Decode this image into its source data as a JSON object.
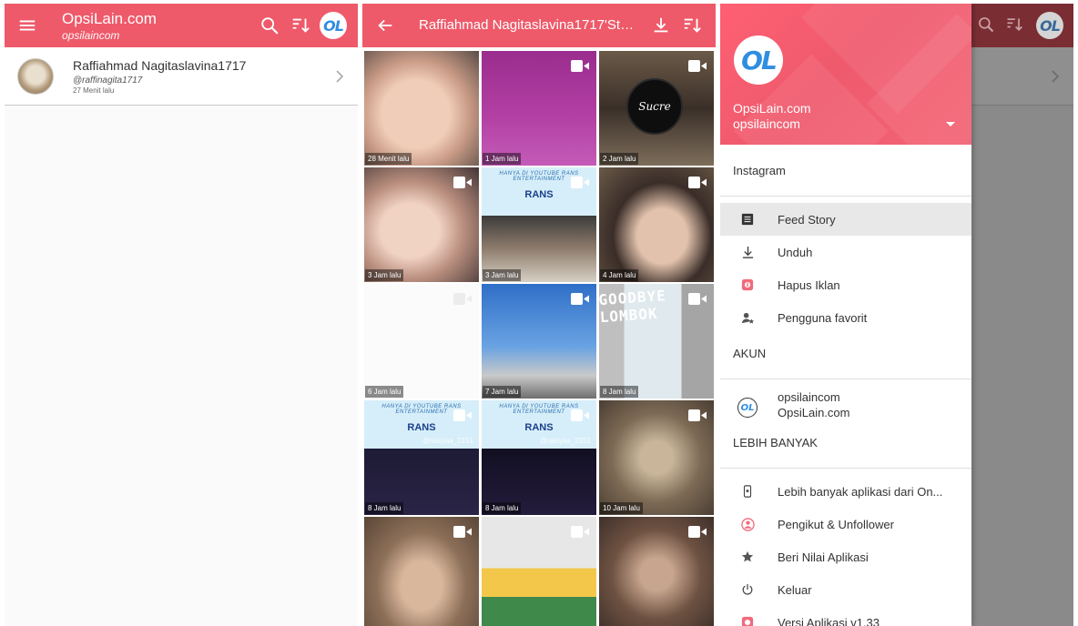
{
  "app": {
    "title": "OpsiLain.com",
    "subtitle": "opsilaincom",
    "logo_text": "OL"
  },
  "colors": {
    "accent": "#ee5a6a",
    "drawer_header": "#f26476",
    "logo_blue": "#2f8ee0"
  },
  "user_list": [
    {
      "name": "Raffiahmad Nagitaslavina1717",
      "handle": "@raffinagita1717",
      "time": "27 Menit lalu"
    }
  ],
  "story": {
    "title": "Raffiahmad Nagitaslavina1717'Sto...",
    "icons": [
      "back-arrow-icon",
      "download-icon",
      "sort-icon"
    ],
    "tiles": [
      {
        "time": "28 Menit lalu",
        "video": false
      },
      {
        "time": "1 Jam lalu",
        "video": true
      },
      {
        "time": "2 Jam lalu",
        "video": true,
        "sign": "Sucre"
      },
      {
        "time": "3 Jam lalu",
        "video": true
      },
      {
        "time": "3 Jam lalu",
        "video": true,
        "ad": "HANYA DI YOUTUBE RANS ENTERTAINMENT",
        "brand": "RANS"
      },
      {
        "time": "4 Jam lalu",
        "video": true
      },
      {
        "time": "6 Jam lalu",
        "video": true
      },
      {
        "time": "7 Jam lalu",
        "video": true
      },
      {
        "time": "8 Jam lalu",
        "video": true,
        "overlay": "GOODBYE LOMBOK"
      },
      {
        "time": "8 Jam lalu",
        "video": true,
        "ad": "HANYA DI YOUTUBE RANS ENTERTAINMENT",
        "brand": "RANS",
        "watermark": "@raisyaa_2151"
      },
      {
        "time": "8 Jam lalu",
        "video": true,
        "ad": "HANYA DI YOUTUBE RANS ENTERTAINMENT",
        "brand": "RANS",
        "watermark": "@raisyaa_2151"
      },
      {
        "time": "10 Jam lalu",
        "video": true
      },
      {
        "time": "",
        "video": true
      },
      {
        "time": "",
        "video": true
      },
      {
        "time": "",
        "video": true
      }
    ]
  },
  "drawer": {
    "header_name": "OpsiLain.com",
    "header_account": "opsilaincom",
    "section_instagram": "Instagram",
    "menu_main": [
      {
        "label": "Feed Story",
        "icon": "feed-icon",
        "active": true
      },
      {
        "label": "Unduh",
        "icon": "download-icon",
        "active": false
      },
      {
        "label": "Hapus Iklan",
        "icon": "remove-ads-icon",
        "active": false
      },
      {
        "label": "Pengguna favorit",
        "icon": "favorite-user-icon",
        "active": false
      }
    ],
    "section_account": "AKUN",
    "account": {
      "handle": "opsilaincom",
      "name": "OpsiLain.com"
    },
    "section_more": "LEBIH BANYAK",
    "menu_more": [
      {
        "label": "Lebih banyak aplikasi dari On...",
        "icon": "more-apps-icon"
      },
      {
        "label": "Pengikut & Unfollower",
        "icon": "followers-icon"
      },
      {
        "label": "Beri Nilai Aplikasi",
        "icon": "star-icon"
      },
      {
        "label": "Keluar",
        "icon": "power-icon"
      },
      {
        "label": "Versi Aplikasi v1.33",
        "icon": "version-icon"
      }
    ]
  }
}
